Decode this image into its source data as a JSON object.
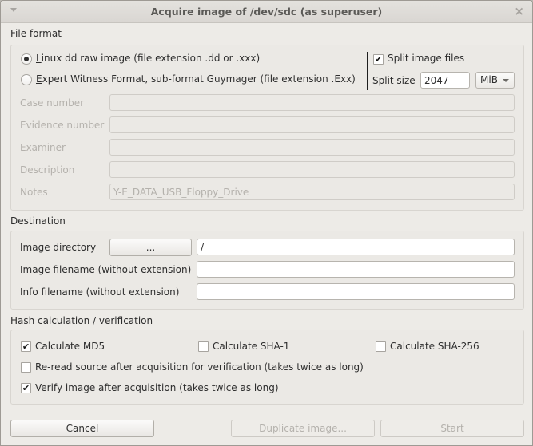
{
  "window": {
    "title": "Acquire image of /dev/sdc (as superuser)",
    "menu_icon": "triangle-down-icon",
    "close_icon": "×"
  },
  "file_format": {
    "section_title": "File format",
    "radio_options": [
      {
        "label_accel": "L",
        "label_rest": "inux dd raw image (file extension .dd or .xxx)",
        "checked": true
      },
      {
        "label_accel": "E",
        "label_rest": "xpert Witness Format, sub-format Guymager (file extension .Exx)",
        "checked": false
      }
    ],
    "split_image_files": {
      "label": "Split image files",
      "checked": true
    },
    "split_size": {
      "label": "Split size",
      "value": "2047",
      "unit": "MiB"
    },
    "fields": [
      {
        "label": "Case number",
        "value": ""
      },
      {
        "label": "Evidence number",
        "value": ""
      },
      {
        "label": "Examiner",
        "value": ""
      },
      {
        "label": "Description",
        "value": ""
      },
      {
        "label": "Notes",
        "value": "Y-E_DATA_USB_Floppy_Drive"
      }
    ]
  },
  "destination": {
    "section_title": "Destination",
    "image_directory": {
      "label": "Image directory",
      "browse_label": "...",
      "value": "/"
    },
    "image_filename": {
      "label": "Image filename (without extension)",
      "value": ""
    },
    "info_filename": {
      "label": "Info filename (without extension)",
      "value": ""
    }
  },
  "hash": {
    "section_title": "Hash calculation / verification",
    "md5": {
      "label": "Calculate MD5",
      "checked": true
    },
    "sha1": {
      "label": "Calculate SHA-1",
      "checked": false
    },
    "sha256": {
      "label": "Calculate SHA-256",
      "checked": false
    },
    "reread": {
      "label": "Re-read source after acquisition for verification (takes twice as long)",
      "checked": false
    },
    "verify": {
      "label": "Verify image after acquisition (takes twice as long)",
      "checked": true
    }
  },
  "buttons": {
    "cancel": "Cancel",
    "duplicate": "Duplicate image...",
    "start": "Start"
  },
  "check_mark": "✔"
}
